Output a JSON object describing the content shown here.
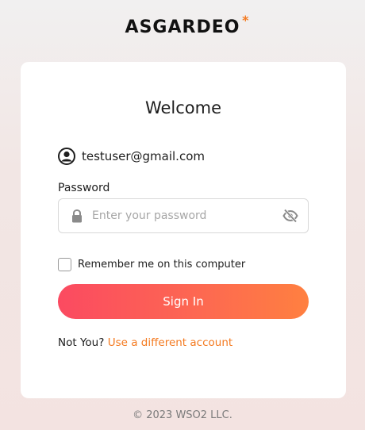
{
  "brand": {
    "name": "ASGARDEO",
    "star": "*",
    "accent_color": "#f47a20"
  },
  "card": {
    "title": "Welcome",
    "user": {
      "email": "testuser@gmail.com",
      "icon": "user-avatar-icon"
    },
    "password": {
      "label": "Password",
      "placeholder": "Enter your password",
      "value": "",
      "lock_icon": "lock-icon",
      "toggle_icon": "eye-off-icon"
    },
    "remember": {
      "label": "Remember me on this computer",
      "checked": false
    },
    "signin_label": "Sign In",
    "not_you": {
      "prefix": "Not You?",
      "link": "Use a different account"
    }
  },
  "footer": {
    "copyright": "© 2023 WSO2 LLC."
  },
  "colors": {
    "button_start": "#fb4a61",
    "button_end": "#ff8040",
    "link": "#f47a20"
  }
}
